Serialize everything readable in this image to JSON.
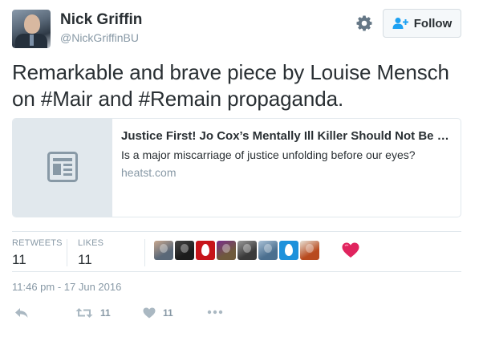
{
  "user": {
    "display_name": "Nick Griffin",
    "screen_name": "@NickGriffinBU"
  },
  "header": {
    "follow_label": "Follow",
    "settings_icon": "gear-icon",
    "follow_icon": "add-user-icon"
  },
  "tweet": {
    "text": "Remarkable and brave piece by Louise Mensch on #Mair and #Remain propaganda."
  },
  "card": {
    "title": "Justice First! Jo Cox’s Mentally Ill Killer Should Not Be Di…",
    "description": "Is a major miscarriage of justice unfolding before our eyes?",
    "domain": "heatst.com",
    "thumb_icon": "article-icon"
  },
  "stats": {
    "retweets_label": "RETWEETS",
    "retweets_count": "11",
    "likes_label": "LIKES",
    "likes_count": "11"
  },
  "likers": [
    {
      "name": "liker-avatar-1",
      "colors": [
        "#5a6878",
        "#c9a88f"
      ]
    },
    {
      "name": "liker-avatar-2",
      "colors": [
        "#1c1c1c",
        "#444444"
      ]
    },
    {
      "name": "liker-avatar-3",
      "colors": [
        "#c7141a",
        "#ffffff"
      ]
    },
    {
      "name": "liker-avatar-4",
      "colors": [
        "#6f5a3c",
        "#7a2f8c"
      ]
    },
    {
      "name": "liker-avatar-5",
      "colors": [
        "#3a3a3a",
        "#9a9a9a"
      ]
    },
    {
      "name": "liker-avatar-6",
      "colors": [
        "#4b6f8f",
        "#a9c1d6"
      ]
    },
    {
      "name": "liker-avatar-7",
      "colors": [
        "#1d91db",
        "#ffffff"
      ]
    },
    {
      "name": "liker-avatar-8",
      "colors": [
        "#b84a1e",
        "#e7e1d6"
      ]
    }
  ],
  "like_heart_color": "#e0245e",
  "timestamp": "11:46 pm - 17 Jun 2016",
  "actions": {
    "retweet_count": "11",
    "like_count": "11"
  }
}
